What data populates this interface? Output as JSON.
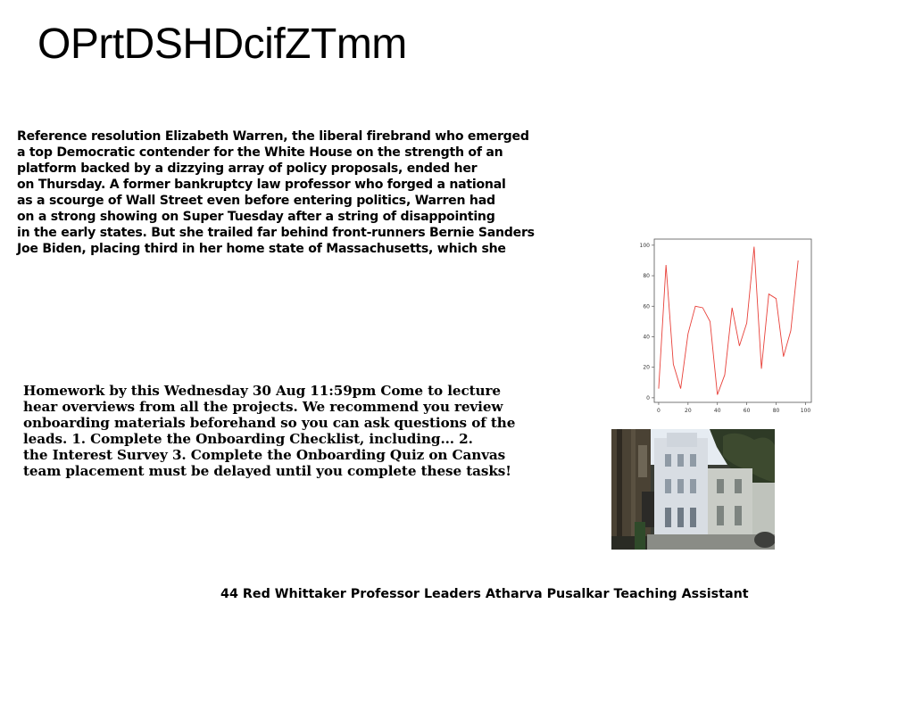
{
  "title": "OPrtDSHDcifZTmm",
  "paragraph1": [
    "Reference resolution Elizabeth Warren, the liberal firebrand who emerged",
    "a top Democratic contender for the White House on the strength of an",
    "platform backed by a dizzying array of policy proposals, ended her",
    "on Thursday. A former bankruptcy law professor who forged a national",
    "as a scourge of Wall Street even before entering politics, Warren had",
    "on a strong showing on Super Tuesday after a string of disappointing",
    "in the early states. But she trailed far behind front-runners Bernie Sanders",
    "Joe Biden, placing third in her home state of Massachusetts, which she"
  ],
  "paragraph2": [
    "Homework by this Wednesday 30 Aug 11:59pm Come to lecture",
    "hear overviews from all the projects. We recommend you review",
    "onboarding materials beforehand so you can ask questions of the",
    "leads. 1. Complete the Onboarding Checklist, including... 2.",
    "the Interest Survey 3. Complete the Onboarding Quiz on Canvas",
    "team placement must be delayed until you complete these tasks!"
  ],
  "footer": "44 Red Whittaker Professor Leaders Atharva Pusalkar Teaching Assistant",
  "chart_data": {
    "type": "line",
    "x": [
      0,
      5,
      10,
      15,
      20,
      25,
      30,
      35,
      40,
      45,
      50,
      55,
      60,
      65,
      70,
      75,
      80,
      85,
      90,
      95,
      100
    ],
    "series": [
      {
        "values": [
          6,
          87,
          22,
          6,
          42,
          60,
          59,
          50,
          2,
          15,
          59,
          34,
          49,
          99,
          19,
          68,
          65,
          27,
          44,
          90
        ]
      }
    ],
    "xticks": [
      "0",
      "20",
      "40",
      "60",
      "80",
      "100"
    ],
    "yticks": [
      "0",
      "20",
      "40",
      "60",
      "80",
      "100"
    ],
    "xlim": [
      -3,
      104
    ],
    "ylim": [
      -3,
      104
    ],
    "line_color": "#e8413a",
    "grid": false
  }
}
